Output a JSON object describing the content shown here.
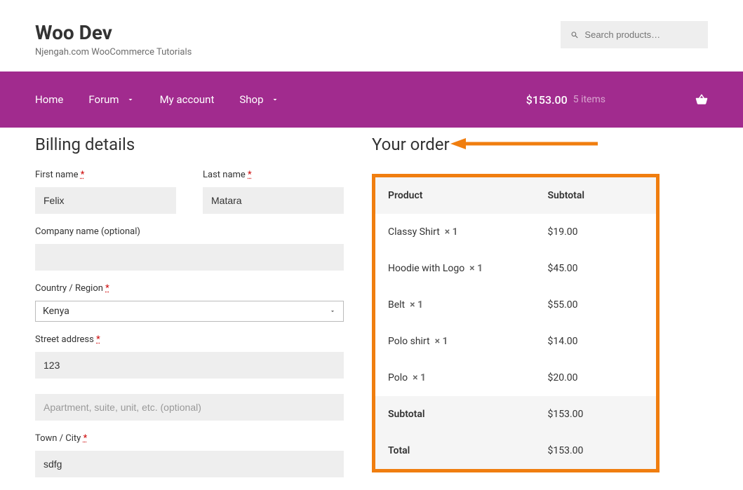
{
  "header": {
    "site_title": "Woo Dev",
    "tagline": "Njengah.com WooCommerce Tutorials",
    "search_placeholder": "Search products…"
  },
  "nav": {
    "items": [
      {
        "label": "Home",
        "has_chevron": false
      },
      {
        "label": "Forum",
        "has_chevron": true
      },
      {
        "label": "My account",
        "has_chevron": false
      },
      {
        "label": "Shop",
        "has_chevron": true
      }
    ],
    "cart_total": "$153.00",
    "cart_items": "5 items"
  },
  "billing": {
    "title": "Billing details",
    "first_name_label": "First name",
    "first_name_value": "Felix",
    "last_name_label": "Last name",
    "last_name_value": "Matara",
    "company_label": "Company name (optional)",
    "company_value": "",
    "country_label": "Country / Region",
    "country_value": "Kenya",
    "street_label": "Street address",
    "street_value": "123",
    "apt_placeholder": "Apartment, suite, unit, etc. (optional)",
    "apt_value": "",
    "town_label": "Town / City",
    "town_value": "sdfg",
    "required_asterisk": "*"
  },
  "order": {
    "title": "Your order",
    "product_col": "Product",
    "subtotal_col": "Subtotal",
    "items": [
      {
        "name": "Classy Shirt",
        "qty": "× 1",
        "subtotal": "$19.00"
      },
      {
        "name": "Hoodie with Logo",
        "qty": "× 1",
        "subtotal": "$45.00"
      },
      {
        "name": "Belt",
        "qty": "× 1",
        "subtotal": "$55.00"
      },
      {
        "name": "Polo shirt",
        "qty": "× 1",
        "subtotal": "$14.00"
      },
      {
        "name": "Polo",
        "qty": "× 1",
        "subtotal": "$20.00"
      }
    ],
    "subtotal_label": "Subtotal",
    "subtotal_value": "$153.00",
    "total_label": "Total",
    "total_value": "$153.00"
  }
}
